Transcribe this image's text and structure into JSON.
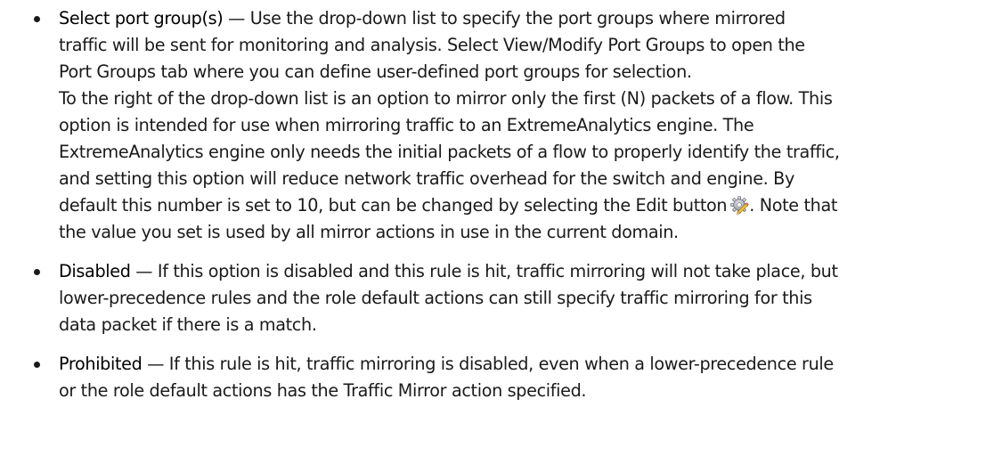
{
  "items": [
    {
      "term": "Select port group(s)",
      "lines": [
        " — Use the drop-down list to specify the port groups where mirrored",
        "traffic will be sent for monitoring and analysis. Select View/Modify Port Groups to open the",
        "Port Groups tab where you can define user-defined port groups for selection.",
        "To the right of the drop-down list is an option to mirror only the first (N) packets of a flow. This",
        "option is intended for use when mirroring traffic to an ExtremeAnalytics engine. The",
        "ExtremeAnalytics engine only needs the initial packets of a flow to properly identify the traffic,",
        "and setting this option will reduce network traffic overhead for the switch and engine. By",
        "default this number is set to 10, but can be changed by selecting the Edit button",
        ". Note that",
        "the value you set is used by all mirror actions in use in the current domain."
      ]
    },
    {
      "term": "Disabled",
      "lines": [
        " — If this option is disabled and this rule is hit, traffic mirroring will not take place, but",
        "lower-precedence rules and the role default actions can still specify traffic mirroring for this",
        "data packet if there is a match."
      ]
    },
    {
      "term": "Prohibited",
      "lines": [
        " — If this rule is hit, traffic mirroring is disabled, even when a lower-precedence rule",
        "or the role default actions has the Traffic Mirror action specified."
      ]
    }
  ],
  "icons": {
    "edit": "edit-gear-icon"
  }
}
